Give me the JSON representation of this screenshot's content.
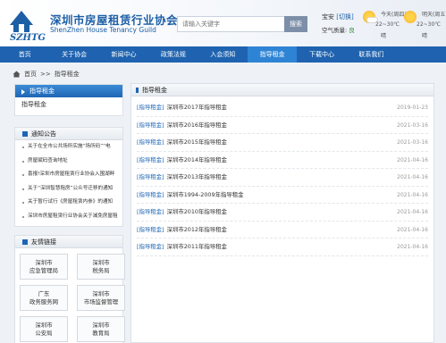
{
  "header": {
    "logo_letters": "SZHTG",
    "title_cn": "深圳市房屋租赁行业协会",
    "title_en": "ShenZhen House Tenancy Guild",
    "search": {
      "placeholder": "请输入关键字",
      "button": "搜索"
    },
    "city": "宝安",
    "city_switch": "[切换]",
    "aqi_label": "空气质量:",
    "aqi_grade": "良",
    "weather": [
      {
        "day": "今天(周四)",
        "temp": "22~30℃",
        "desc": "晴"
      },
      {
        "day": "明天(周五)",
        "temp": "22~30℃",
        "desc": "晴"
      }
    ],
    "colors": {
      "brand": "#1d5fa6",
      "nav": "#1f63b0",
      "nav_active": "#2e84d4"
    }
  },
  "nav": [
    {
      "label": "首页",
      "active": false
    },
    {
      "label": "关于协会",
      "active": false
    },
    {
      "label": "新闻中心",
      "active": false
    },
    {
      "label": "政策法规",
      "active": false
    },
    {
      "label": "入会须知",
      "active": false
    },
    {
      "label": "指导租金",
      "active": true
    },
    {
      "label": "下载中心",
      "active": false
    },
    {
      "label": "联系我们",
      "active": false
    },
    {
      "label": "",
      "active": false
    }
  ],
  "breadcrumb": {
    "home": "首页",
    "sep": ">>",
    "current": "指导租金"
  },
  "sidebar": {
    "section_title": "指导租金",
    "section_item": "指导租金",
    "notice_title": "通知公告",
    "notices": [
      "关于在全市公共场所实施“场所码”“电",
      "房屋赋码查询地址",
      "喜报!深圳市房屋租赁行业协会入围湖畔",
      "关于“深圳智慧租房”公众号迁移的通知",
      "关于暂行试行《房屋租赁内参》的通知",
      "深圳市房屋租赁行业协会关于减免房屋租"
    ],
    "links_title": "友情链接",
    "links": [
      {
        "line1": "深圳市",
        "line2": "应急管理局"
      },
      {
        "line1": "深圳市",
        "line2": "税务局"
      },
      {
        "line1": "广东",
        "line2": "政务服务网"
      },
      {
        "line1": "深圳市",
        "line2": "市场监督管理"
      },
      {
        "line1": "深圳市",
        "line2": "公安局"
      },
      {
        "line1": "深圳市",
        "line2": "教育局"
      }
    ]
  },
  "main": {
    "title": "指导租金",
    "rows": [
      {
        "cat": "[指导租金]",
        "title": "深圳市2017年指导租金",
        "date": "2019-01-23"
      },
      {
        "cat": "[指导租金]",
        "title": "深圳市2016年指导租金",
        "date": "2021-03-16"
      },
      {
        "cat": "[指导租金]",
        "title": "深圳市2015年指导租金",
        "date": "2021-03-16"
      },
      {
        "cat": "[指导租金]",
        "title": "深圳市2014年指导租金",
        "date": "2021-04-16"
      },
      {
        "cat": "[指导租金]",
        "title": "深圳市2013年指导租金",
        "date": "2021-04-16"
      },
      {
        "cat": "[指导租金]",
        "title": "深圳市1994-2009年指导租金",
        "date": "2021-04-16"
      },
      {
        "cat": "[指导租金]",
        "title": "深圳市2010年指导租金",
        "date": "2021-04-16"
      },
      {
        "cat": "[指导租金]",
        "title": "深圳市2012年指导租金",
        "date": "2021-04-16"
      },
      {
        "cat": "[指导租金]",
        "title": "深圳市2011年指导租金",
        "date": "2021-04-16"
      }
    ]
  }
}
